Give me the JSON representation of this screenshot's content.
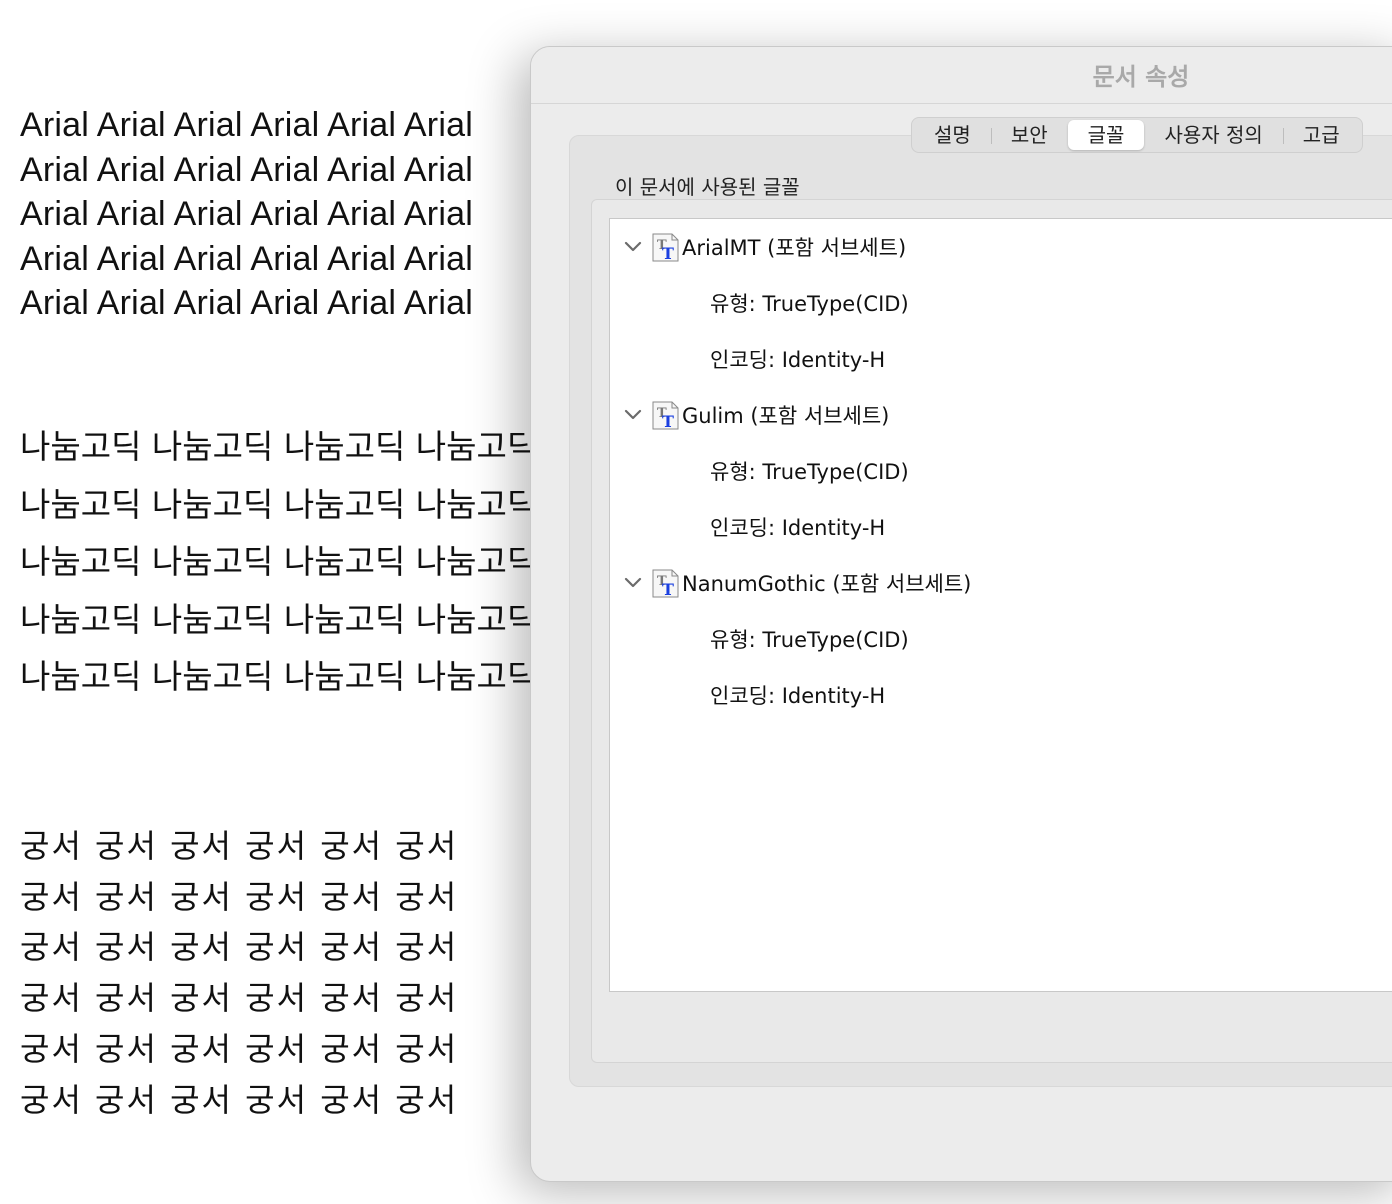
{
  "document": {
    "arial_lines": [
      "Arial Arial Arial Arial Arial Arial",
      "Arial Arial Arial Arial Arial Arial",
      "Arial Arial Arial Arial Arial Arial",
      "Arial Arial Arial Arial Arial Arial",
      "Arial Arial Arial Arial Arial Arial"
    ],
    "nanum_lines": [
      "나눔고딕 나눔고딕 나눔고딕 나눔고딕",
      "나눔고딕 나눔고딕 나눔고딕 나눔고딕",
      "나눔고딕 나눔고딕 나눔고딕 나눔고딕",
      "나눔고딕 나눔고딕 나눔고딕 나눔고딕",
      "나눔고딕 나눔고딕 나눔고딕 나눔고딕"
    ],
    "gungseo_lines": [
      "궁서 궁서 궁서 궁서 궁서 궁서",
      "궁서 궁서 궁서 궁서 궁서 궁서",
      "궁서 궁서 궁서 궁서 궁서 궁서",
      "궁서 궁서 궁서 궁서 궁서 궁서",
      "궁서 궁서 궁서 궁서 궁서 궁서",
      "궁서 궁서 궁서 궁서 궁서 궁서"
    ]
  },
  "dialog": {
    "title": "문서 속성",
    "tabs": [
      {
        "label": "설명",
        "active": false
      },
      {
        "label": "보안",
        "active": false
      },
      {
        "label": "글꼴",
        "active": true
      },
      {
        "label": "사용자 정의",
        "active": false
      },
      {
        "label": "고급",
        "active": false
      }
    ],
    "section_label": "이 문서에 사용된 글꼴",
    "fonts": [
      {
        "name": "ArialMT (포함 서브세트)",
        "type": "유형: TrueType(CID)",
        "encoding": "인코딩: Identity-H",
        "icon": "font-file-icon"
      },
      {
        "name": "Gulim (포함 서브세트)",
        "type": "유형: TrueType(CID)",
        "encoding": "인코딩: Identity-H",
        "icon": "font-file-icon"
      },
      {
        "name": "NanumGothic (포함 서브세트)",
        "type": "유형: TrueType(CID)",
        "encoding": "인코딩: Identity-H",
        "icon": "font-file-icon"
      }
    ]
  },
  "colors": {
    "title_text": "#a9a9a9",
    "font_icon_blue": "#1a3fe0",
    "dialog_bg": "#ececec"
  }
}
